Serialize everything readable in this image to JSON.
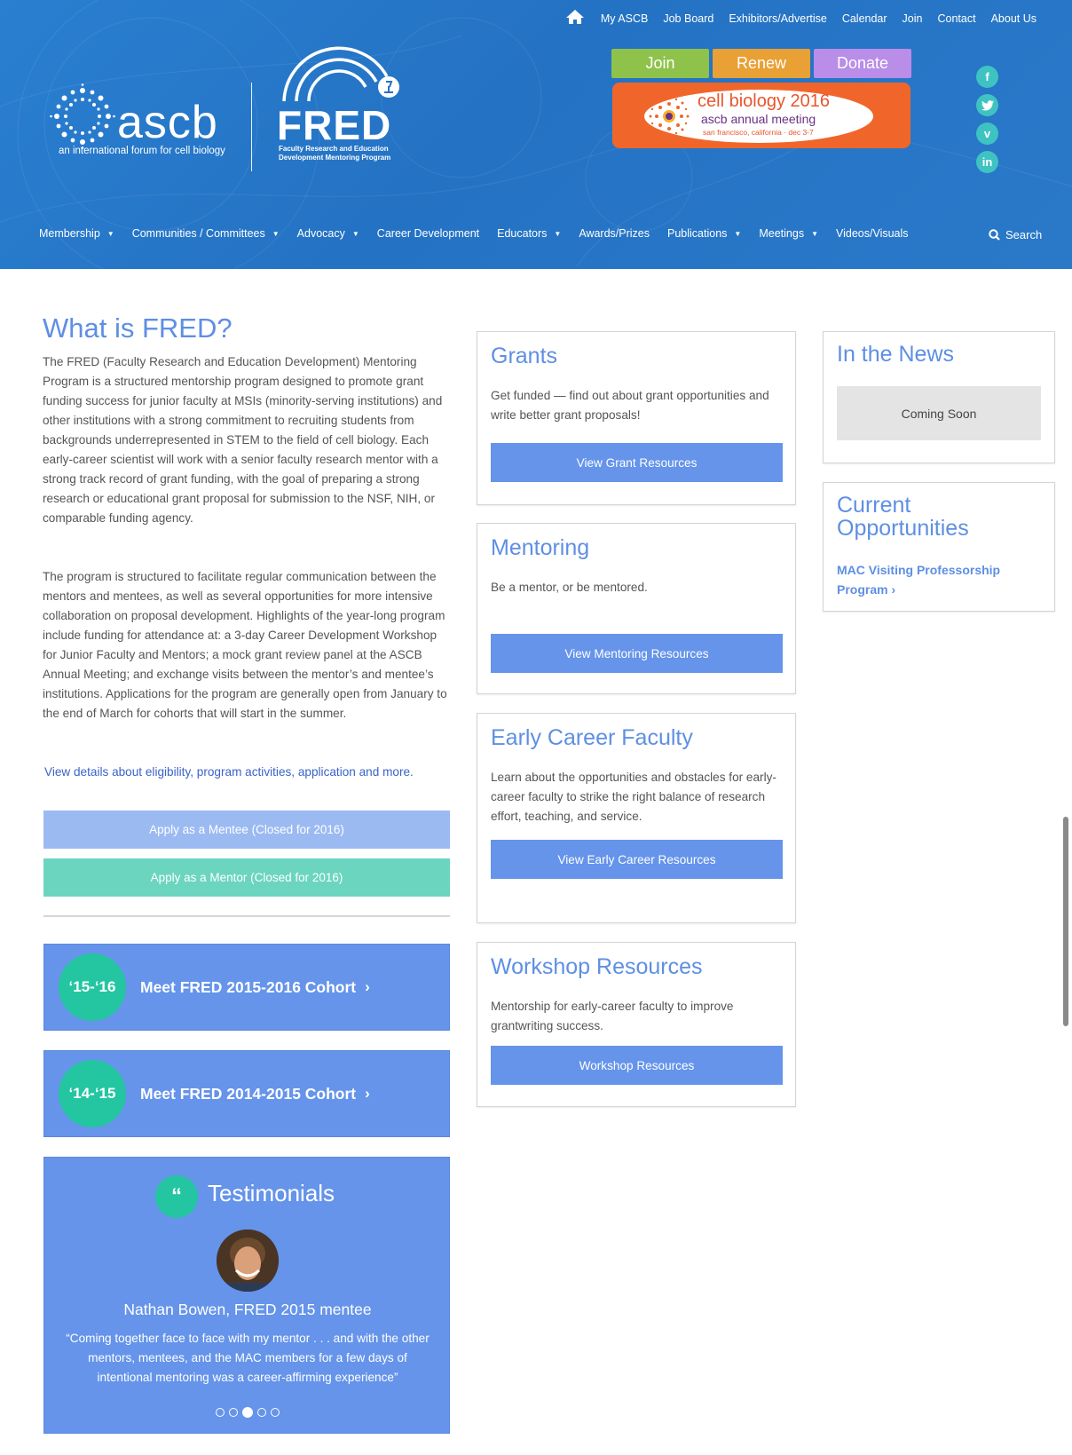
{
  "topnav": {
    "items": [
      "My ASCB",
      "Job Board",
      "Exhibitors/Advertise",
      "Calendar",
      "Join",
      "Contact",
      "About Us"
    ]
  },
  "action_buttons": {
    "join": "Join",
    "renew": "Renew",
    "donate": "Donate"
  },
  "meeting_banner": {
    "line1": "cell biology 2016",
    "line2": "ascb annual meeting",
    "line3": "san francisco, california · dec 3-7"
  },
  "social": {
    "facebook": "f",
    "twitter": "t",
    "vimeo": "v",
    "linkedin": "in"
  },
  "logo": {
    "ascb_word": "ascb",
    "ascb_tagline": "an international forum for cell biology",
    "fred_word": "FRED",
    "fred_sub_1": "Faculty Research and Education",
    "fred_sub_2": "Development Mentoring Program"
  },
  "mainnav": {
    "items": [
      {
        "label": "Membership",
        "caret": true
      },
      {
        "label": "Communities / Committees",
        "caret": true
      },
      {
        "label": "Advocacy",
        "caret": true
      },
      {
        "label": "Career Development",
        "caret": false
      },
      {
        "label": "Educators",
        "caret": true
      },
      {
        "label": "Awards/Prizes",
        "caret": false
      },
      {
        "label": "Publications",
        "caret": true
      },
      {
        "label": "Meetings",
        "caret": true
      },
      {
        "label": "Videos/Visuals",
        "caret": false
      }
    ],
    "search": "Search"
  },
  "intro": {
    "title": "What is FRED?",
    "para1": "The FRED (Faculty Research and Education Development) Mentoring Program is a structured mentorship program designed to promote grant funding success for junior faculty at MSIs (minority-serving institutions) and other institutions with a strong commitment to recruiting students from backgrounds underrepresented in STEM to the field of cell biology. Each early-career scientist will work with a senior faculty research mentor with a strong track record of grant funding, with the goal of preparing a strong research or educational grant proposal for submission to the NSF, NIH, or comparable funding agency.",
    "para2": "The program is structured to facilitate regular communication between the mentors and mentees, as well as several opportunities for more intensive collaboration on proposal development. Highlights of the year-long program include funding for attendance at: a 3-day Career Development Workshop for Junior Faculty and Mentors; a mock grant review panel at the ASCB Annual Meeting; and exchange visits between the mentor’s and mentee’s institutions. Applications for the program are generally open from January to the end of March for cohorts that will start in the summer.",
    "details_link": "View details about eligibility, program activities, application and more.",
    "apply_mentee": "Apply as a Mentee (Closed for 2016)",
    "apply_mentor": "Apply as a Mentor (Closed for 2016)"
  },
  "cohorts": [
    {
      "badge": "‘15-‘16",
      "label": "Meet FRED 2015-2016 Cohort"
    },
    {
      "badge": "‘14-‘15",
      "label": "Meet FRED 2014-2015 Cohort"
    }
  ],
  "testimonials": {
    "title": "Testimonials",
    "quote_mark": "“",
    "name": "Nathan Bowen, FRED 2015 mentee",
    "quote": "“Coming together face to face with my mentor . . . and with the other mentors, mentees, and the MAC members for a few days of intentional mentoring was a career-affirming experience”",
    "dot_count": 5,
    "active_dot": 3
  },
  "cards": {
    "grants": {
      "title": "Grants",
      "text": "Get funded — find out about grant opportunities and write better grant proposals!",
      "button": "View Grant Resources"
    },
    "mentoring": {
      "title": "Mentoring",
      "text": "Be a mentor, or be mentored.",
      "button": "View Mentoring Resources"
    },
    "early": {
      "title": "Early Career Faculty",
      "text": "Learn about the opportunities and obstacles for early-career faculty to strike the right balance of research effort, teaching, and service.",
      "button": "View Early Career Resources"
    },
    "workshop": {
      "title": "Workshop Resources",
      "text": "Mentorship for early-career faculty to improve grantwriting success.",
      "button": "Workshop Resources"
    }
  },
  "news": {
    "title": "In the News",
    "coming_soon": "Coming Soon"
  },
  "opportunities": {
    "title": "Current Opportunities",
    "link": "MAC Visiting Professorship Program"
  },
  "colors": {
    "header_blue": "#2472c4",
    "accent_blue": "#6594ea",
    "title_blue": "#5e8fe3",
    "teal": "#23c6a0",
    "join_green": "#8fc24a",
    "renew_orange": "#e9a034",
    "donate_purple": "#b98de8",
    "banner_orange": "#f0662a"
  }
}
